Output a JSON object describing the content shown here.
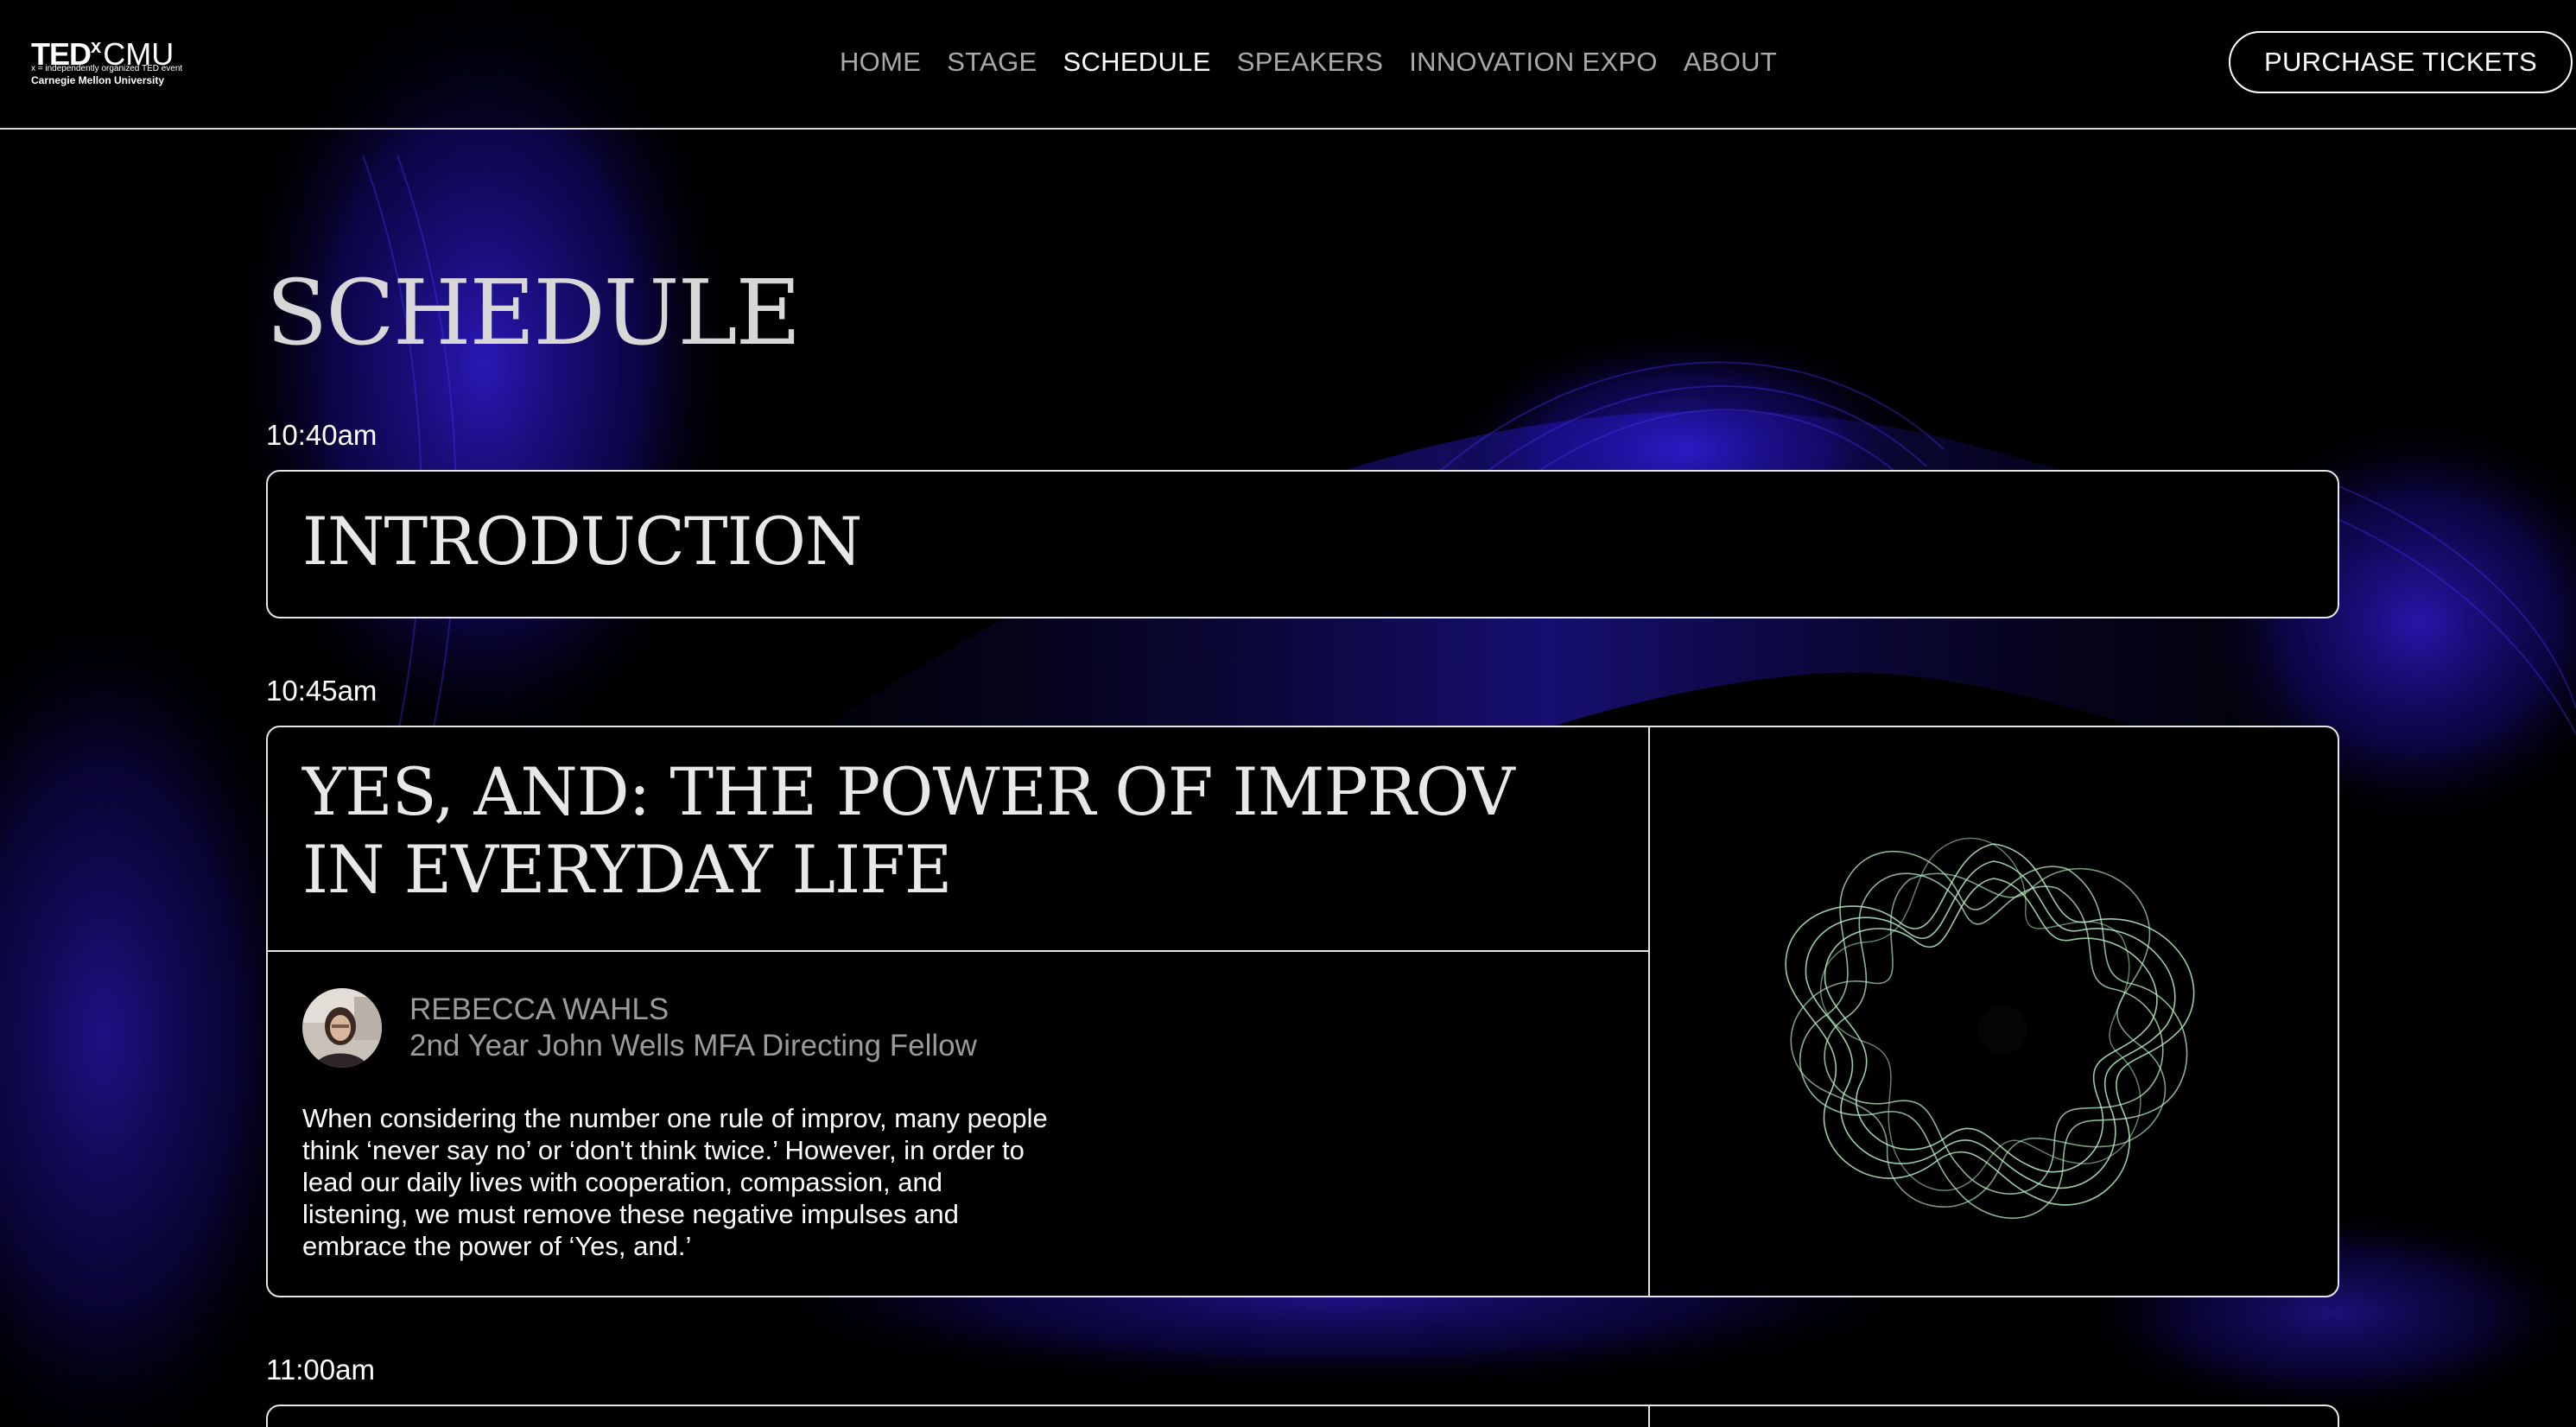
{
  "header": {
    "logo": {
      "ted": "TED",
      "x": "x",
      "cmu": "CMU",
      "tagline": "x = independently organized TED event",
      "university": "Carnegie Mellon University"
    },
    "nav": [
      {
        "label": "HOME",
        "active": false
      },
      {
        "label": "STAGE",
        "active": false
      },
      {
        "label": "SCHEDULE",
        "active": true
      },
      {
        "label": "SPEAKERS",
        "active": false
      },
      {
        "label": "INNOVATION EXPO",
        "active": false
      },
      {
        "label": "ABOUT",
        "active": false
      }
    ],
    "cta_label": "PURCHASE TICKETS"
  },
  "main": {
    "title": "SCHEDULE",
    "sessions": [
      {
        "time": "10:40am",
        "title": "INTRODUCTION"
      },
      {
        "time": "10:45am",
        "title": "YES, AND: THE POWER OF IMPROV IN EVERYDAY LIFE",
        "speaker": {
          "name": "REBECCA WAHLS",
          "role": "2nd Year John Wells MFA Directing Fellow"
        },
        "description": "When considering the number one rule of improv, many people think ‘never say no’ or ‘don't think twice.’ However, in order to lead our daily lives with cooperation, compassion, and listening, we must remove these negative impulses and embrace the power of ‘Yes, and.’"
      },
      {
        "time": "11:00am"
      }
    ]
  },
  "colors": {
    "background": "#000000",
    "accent_wave": "#2a1bd6",
    "art_green": "#b8f0c4",
    "nav_inactive": "#a9a9a9",
    "speaker_text": "#9b9b9b"
  },
  "icons": {
    "avatar": "speaker-avatar-photo",
    "talk_art": "green-flower-wave-art"
  }
}
